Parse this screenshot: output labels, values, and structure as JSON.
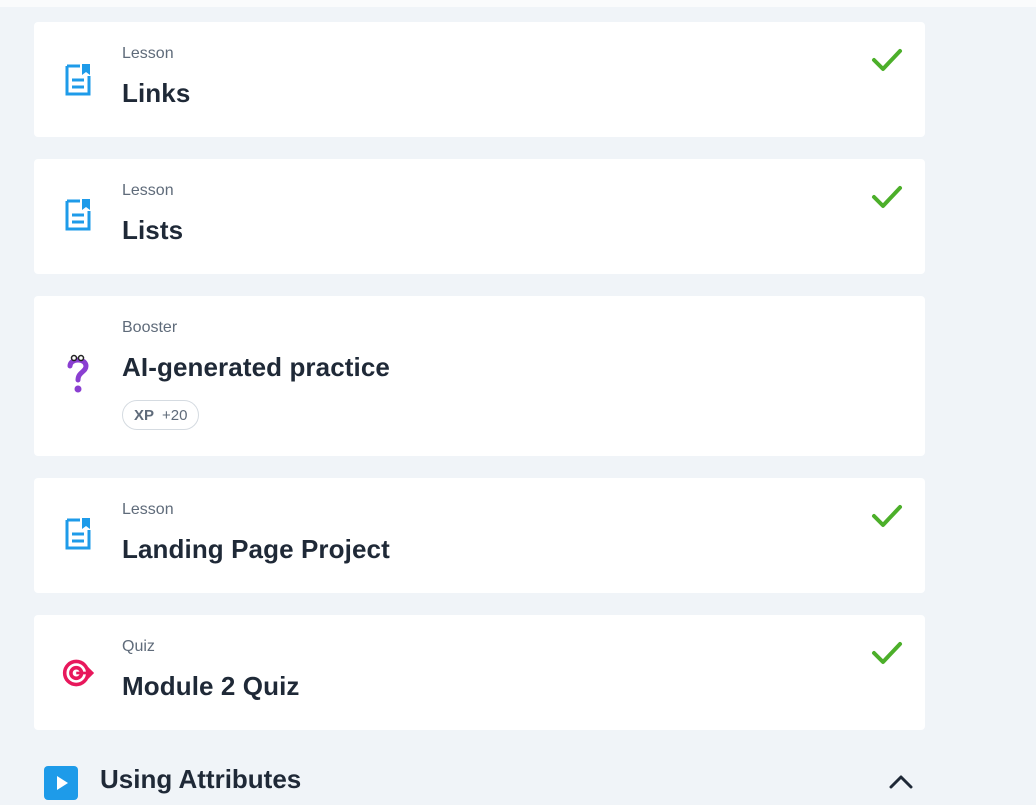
{
  "items": [
    {
      "type": "Lesson",
      "title": "Links",
      "icon": "lesson-doc-icon",
      "completed": true
    },
    {
      "type": "Lesson",
      "title": "Lists",
      "icon": "lesson-doc-icon",
      "completed": true
    },
    {
      "type": "Booster",
      "title": "AI-generated practice",
      "icon": "question-mark-icon",
      "completed": false,
      "xp": {
        "label": "XP",
        "value": "+20"
      }
    },
    {
      "type": "Lesson",
      "title": "Landing Page Project",
      "icon": "lesson-doc-icon",
      "completed": true
    },
    {
      "type": "Quiz",
      "title": "Module 2 Quiz",
      "icon": "target-icon",
      "completed": true
    }
  ],
  "section": {
    "title": "Using Attributes",
    "icon": "play-icon",
    "expanded": true
  },
  "colors": {
    "check": "#4caf2a",
    "lesson_icon": "#1e9be9",
    "booster_icon": "#8a3fd1",
    "quiz_icon": "#e8185c"
  }
}
